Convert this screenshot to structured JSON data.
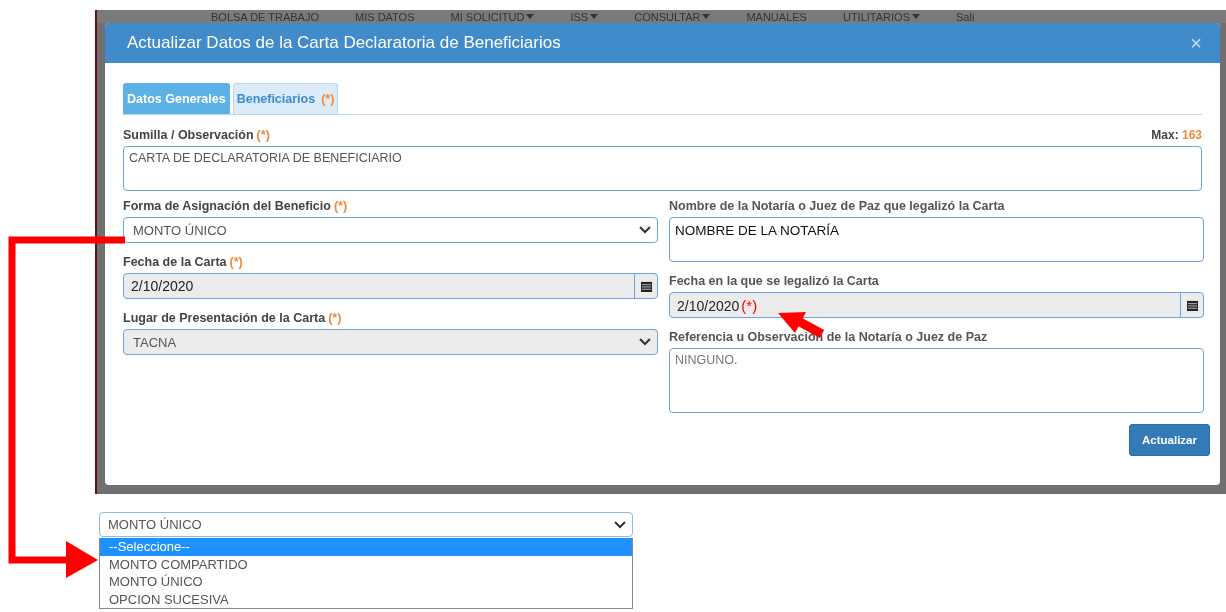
{
  "background_nav": [
    {
      "label": "BOLSA DE TRABAJO",
      "has_menu": false
    },
    {
      "label": "MIS DATOS",
      "has_menu": false
    },
    {
      "label": "MI SOLICITUD",
      "has_menu": true
    },
    {
      "label": "ISS",
      "has_menu": true
    },
    {
      "label": "CONSULTAR",
      "has_menu": true
    },
    {
      "label": "MANUALES",
      "has_menu": false
    },
    {
      "label": "UTILITARIOS",
      "has_menu": true
    },
    {
      "label": "Sali",
      "has_menu": false
    }
  ],
  "modal": {
    "title": "Actualizar Datos de la Carta Declaratoria de Beneficiarios",
    "close": "×",
    "tabs": [
      {
        "label": "Datos Generales",
        "selected": true
      },
      {
        "label": "Beneficiarios",
        "required": "(*)",
        "selected": false
      }
    ],
    "summary": {
      "label": "Sumilla / Observación",
      "required": "(*)",
      "value": "CARTA DE DECLARATORIA DE BENEFICIARIO",
      "max_label": "Max:",
      "max_value": "163"
    },
    "left_fields": [
      {
        "kind": "select",
        "label": "Forma de Asignación del Beneficio",
        "required": "(*)",
        "value": "MONTO ÚNICO",
        "disabled": false
      },
      {
        "kind": "date",
        "label": "Fecha de la Carta",
        "required": "(*)",
        "value": "2/10/2020",
        "disabled": true
      },
      {
        "kind": "select",
        "label": "Lugar de Presentación de la Carta",
        "required": "(*)",
        "value": "TACNA",
        "disabled": true
      }
    ],
    "right_fields": [
      {
        "kind": "textarea",
        "label": "Nombre de la Notaría o Juez de Paz que legalizó la Carta",
        "value": "NOMBRE DE LA NOTARÍA",
        "muted": false
      },
      {
        "kind": "date",
        "label": "Fecha en la que se legalizó la Carta",
        "value": "2/10/2020",
        "marker": "(*)",
        "disabled": true
      },
      {
        "kind": "textarea",
        "label": "Referencia u Observación de la Notaría o Juez de Paz",
        "value": "NINGUNO.",
        "muted": true
      }
    ],
    "button": "Actualizar"
  },
  "dropdown": {
    "value": "MONTO ÚNICO",
    "options": [
      {
        "label": "--Seleccione--",
        "highlighted": true
      },
      {
        "label": "MONTO COMPARTIDO",
        "highlighted": false
      },
      {
        "label": "MONTO ÚNICO",
        "highlighted": false
      },
      {
        "label": "OPCION SUCESIVA",
        "highlighted": false
      }
    ]
  }
}
